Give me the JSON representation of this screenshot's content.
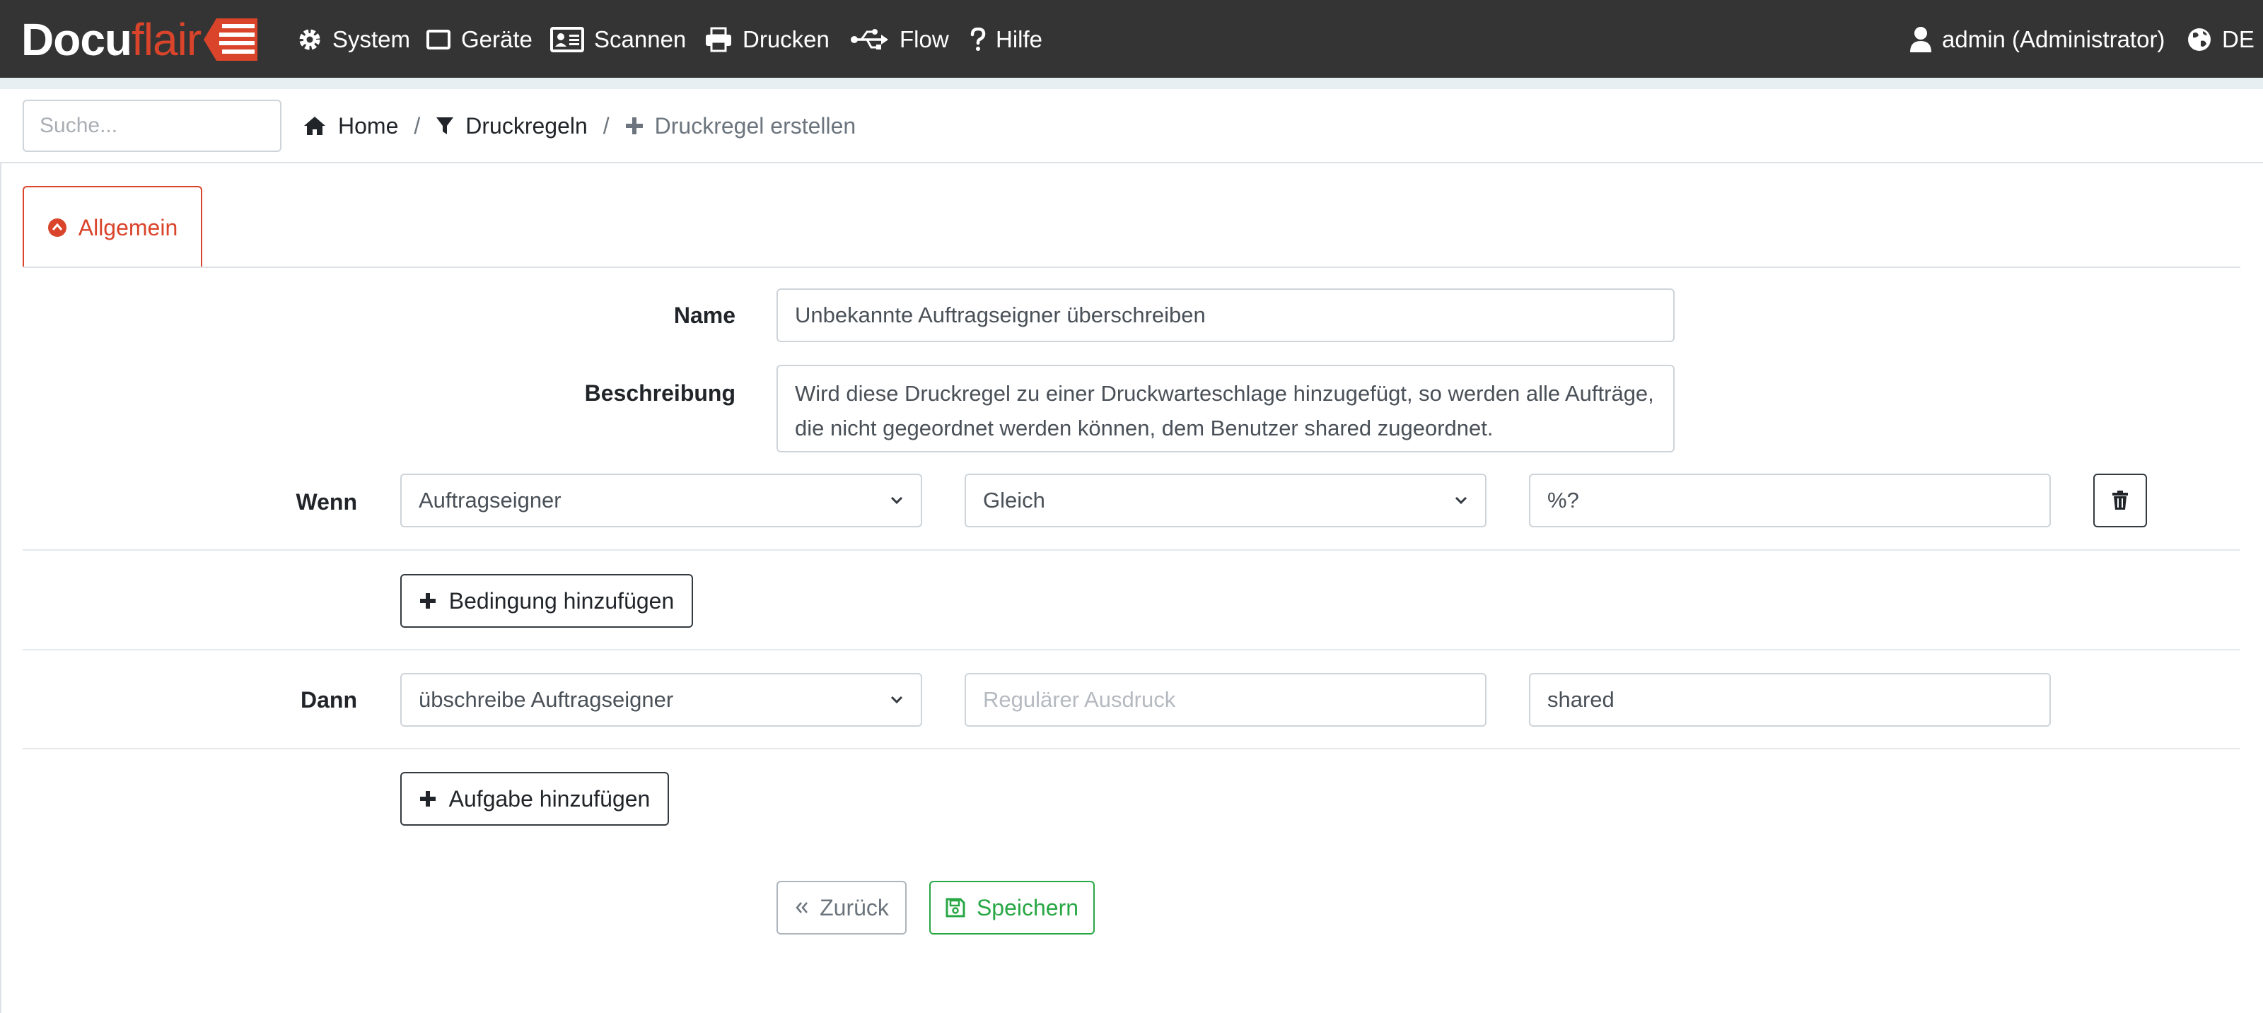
{
  "brand": {
    "part1": "Docu",
    "part2": "flair"
  },
  "nav": {
    "items": [
      {
        "label": "System",
        "icon": "gear-icon"
      },
      {
        "label": "Geräte",
        "icon": "device-icon"
      },
      {
        "label": "Scannen",
        "icon": "id-card-icon"
      },
      {
        "label": "Drucken",
        "icon": "printer-icon"
      },
      {
        "label": "Flow",
        "icon": "usb-icon"
      },
      {
        "label": "Hilfe",
        "icon": "question-icon"
      }
    ],
    "user": "admin (Administrator)",
    "language": "DE"
  },
  "search": {
    "placeholder": "Suche..."
  },
  "breadcrumb": {
    "home": "Home",
    "rules": "Druckregeln",
    "current": "Druckregel erstellen",
    "separator": "/"
  },
  "tab": {
    "label": "Allgemein"
  },
  "form": {
    "name_label": "Name",
    "name_value": "Unbekannte Auftragseigner überschreiben",
    "description_label": "Beschreibung",
    "description_value": "Wird diese Druckregel zu einer Druckwarteschlage hinzugefügt, so werden alle Aufträge, die nicht gegeordnet werden können, dem Benutzer shared zugeordnet.",
    "when_label": "Wenn",
    "when_field": "Auftragseigner",
    "when_operator": "Gleich",
    "when_value": "%?",
    "add_condition": "Bedingung hinzufügen",
    "then_label": "Dann",
    "then_action": "übschreibe Auftragseigner",
    "then_regex_placeholder": "Regulärer Ausdruck",
    "then_value": "shared",
    "add_task": "Aufgabe hinzufügen",
    "back_button": "Zurück",
    "save_button": "Speichern"
  },
  "colors": {
    "navbar": "#343434",
    "brand_accent": "#d9442b",
    "save_green": "#28a745"
  }
}
